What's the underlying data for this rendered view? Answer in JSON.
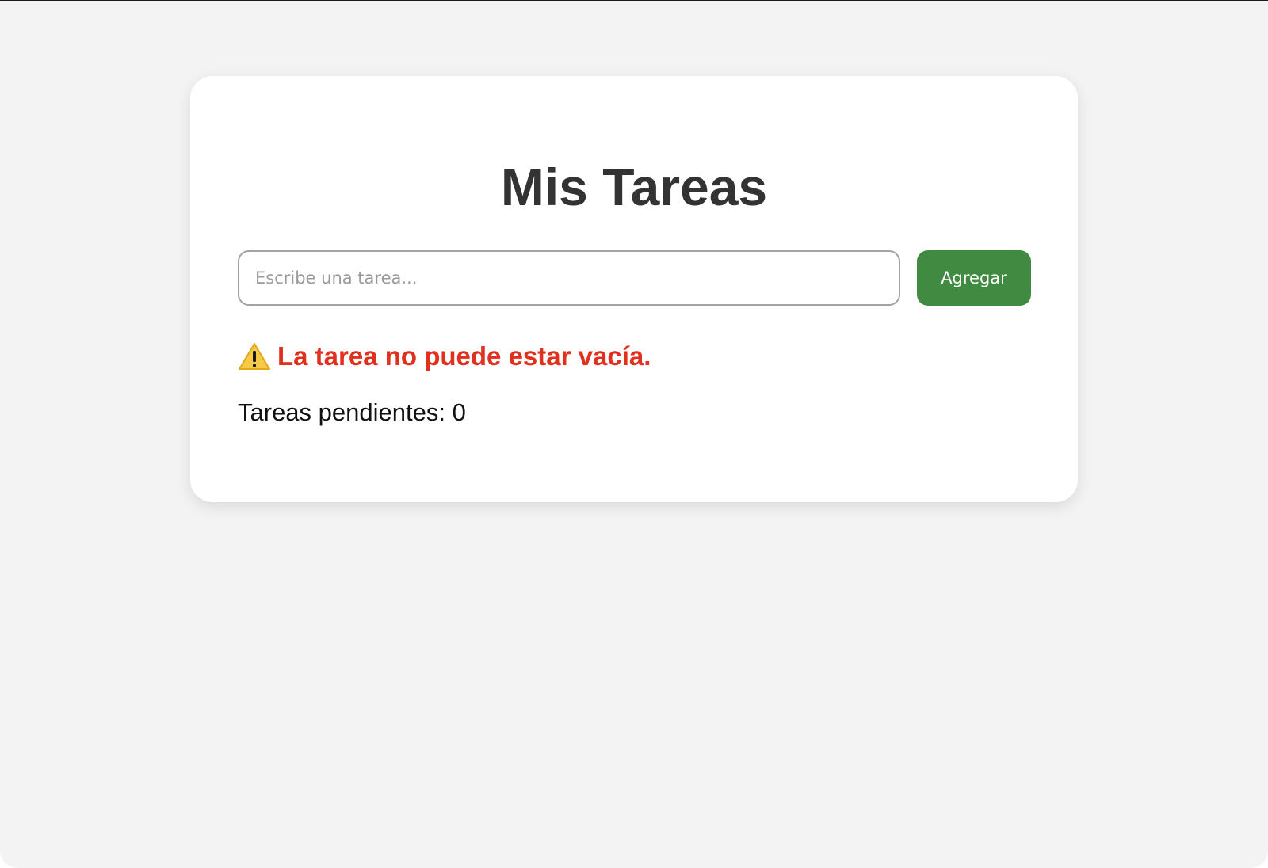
{
  "app": {
    "title": "Mis Tareas"
  },
  "task_form": {
    "input_value": "",
    "input_placeholder": "Escribe una tarea...",
    "add_button_label": "Agregar",
    "add_button_color": "#418a41"
  },
  "error": {
    "icon": "warning-icon",
    "message": "La tarea no puede estar vacía.",
    "color": "#e0301e"
  },
  "status": {
    "pending_label": "Tareas pendientes: ",
    "pending_count": "0"
  }
}
